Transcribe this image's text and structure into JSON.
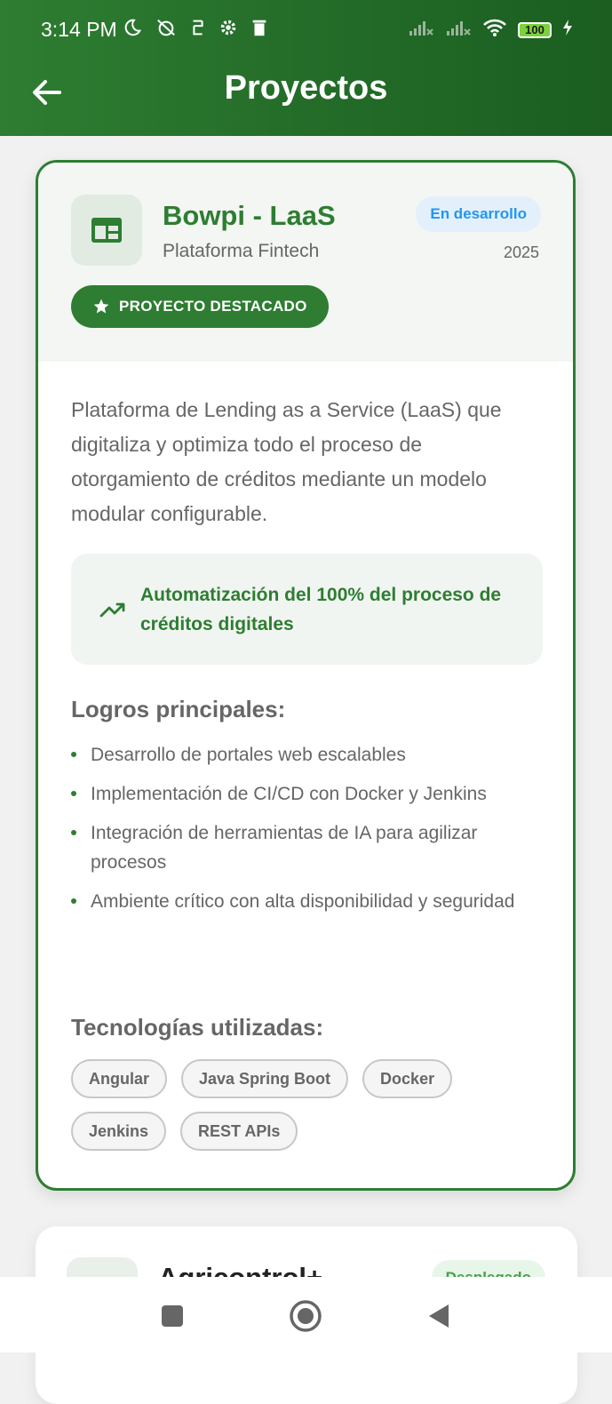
{
  "status_bar": {
    "time": "3:14 PM",
    "battery": "100"
  },
  "header": {
    "title": "Proyectos"
  },
  "project": {
    "name": "Bowpi - LaaS",
    "subtitle": "Plataforma Fintech",
    "status": "En desarrollo",
    "year": "2025",
    "featured_label": "PROYECTO DESTACADO",
    "description": "Plataforma de Lending as a Service (LaaS) que digitaliza y optimiza todo el proceso de otorgamiento de créditos mediante un modelo modular configurable.",
    "impact": "Automatización del 100% del proceso de créditos digitales",
    "achievements_title": "Logros principales:",
    "achievements": [
      "Desarrollo de portales web escalables",
      "Implementación de CI/CD con Docker y Jenkins",
      "Integración de herramientas de IA para agilizar procesos",
      "Ambiente crítico con alta disponibilidad y seguridad"
    ],
    "tech_title": "Tecnologías utilizadas:",
    "technologies": [
      "Angular",
      "Java Spring Boot",
      "Docker",
      "Jenkins",
      "REST APIs"
    ]
  },
  "next_project": {
    "name": "Agricontrol+",
    "status": "Desplegado"
  },
  "colors": {
    "primary": "#2e7d32",
    "status_blue": "#2196f3",
    "status_blue_bg": "#e3f0fb"
  }
}
